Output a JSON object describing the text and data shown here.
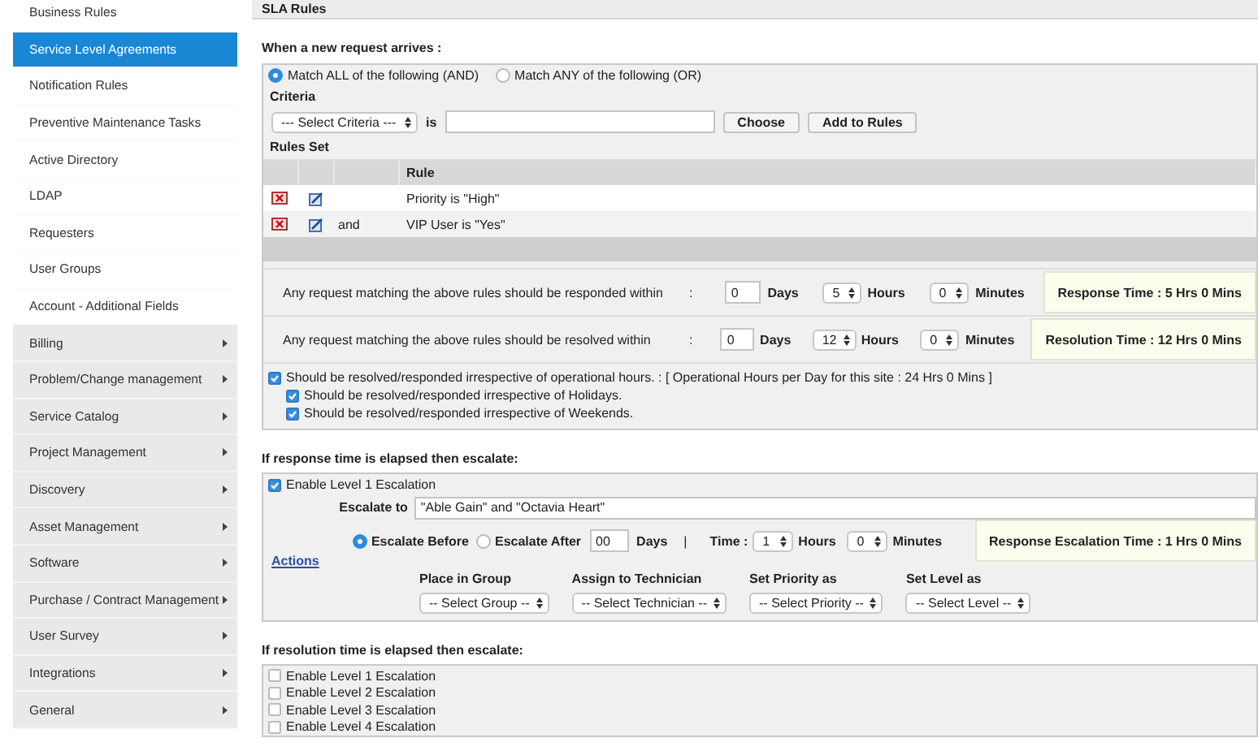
{
  "sidebar": {
    "items": [
      {
        "label": "Business Rules",
        "selected": false,
        "has_submenu": false
      },
      {
        "label": "Service Level Agreements",
        "selected": true,
        "has_submenu": false
      },
      {
        "label": "Notification Rules",
        "selected": false,
        "has_submenu": false
      },
      {
        "label": "Preventive Maintenance Tasks",
        "selected": false,
        "has_submenu": false
      },
      {
        "label": "Active Directory",
        "selected": false,
        "has_submenu": false
      },
      {
        "label": "LDAP",
        "selected": false,
        "has_submenu": false
      },
      {
        "label": "Requesters",
        "selected": false,
        "has_submenu": false
      },
      {
        "label": "User Groups",
        "selected": false,
        "has_submenu": false
      },
      {
        "label": "Account - Additional Fields",
        "selected": false,
        "has_submenu": false
      },
      {
        "label": "Billing",
        "selected": false,
        "has_submenu": true
      },
      {
        "label": "Problem/Change management",
        "selected": false,
        "has_submenu": true
      },
      {
        "label": "Service Catalog",
        "selected": false,
        "has_submenu": true
      },
      {
        "label": "Project Management",
        "selected": false,
        "has_submenu": true
      },
      {
        "label": "Discovery",
        "selected": false,
        "has_submenu": true
      },
      {
        "label": "Asset Management",
        "selected": false,
        "has_submenu": true
      },
      {
        "label": "Software",
        "selected": false,
        "has_submenu": true
      },
      {
        "label": "Purchase / Contract Management",
        "selected": false,
        "has_submenu": true
      },
      {
        "label": "User Survey",
        "selected": false,
        "has_submenu": true
      },
      {
        "label": "Integrations",
        "selected": false,
        "has_submenu": true
      },
      {
        "label": "General",
        "selected": false,
        "has_submenu": true
      }
    ]
  },
  "panel": {
    "title": "SLA Rules"
  },
  "new_request": {
    "heading": "When a new request arrives :",
    "match_options": [
      {
        "label": "Match ALL of the following (AND)",
        "selected": true
      },
      {
        "label": "Match ANY of the following (OR)",
        "selected": false
      }
    ],
    "criteria_label": "Criteria",
    "criteria_select": "--- Select Criteria ---",
    "is_label": "is",
    "choose_button": "Choose",
    "add_button": "Add to Rules",
    "rules_set_label": "Rules Set",
    "rules_table": {
      "columns": [
        "Rule"
      ],
      "rows": [
        {
          "connector": "",
          "rule": "Priority is \"High\""
        },
        {
          "connector": "and",
          "rule": "VIP User is \"Yes\""
        }
      ]
    },
    "times": [
      {
        "label": "Any request matching the above rules should be responded within",
        "separator": ":",
        "days": "0",
        "days_label": "Days",
        "hours": "5",
        "hours_label": "Hours",
        "minutes": "0",
        "minutes_label": "Minutes",
        "summary": "Response Time : 5 Hrs 0 Mins"
      },
      {
        "label": "Any request matching the above rules should be resolved within",
        "separator": ":",
        "days": "0",
        "days_label": "Days",
        "hours": "12",
        "hours_label": "Hours",
        "minutes": "0",
        "minutes_label": "Minutes",
        "summary": "Resolution Time : 12 Hrs 0 Mins"
      }
    ],
    "options": [
      {
        "label": "Should be resolved/responded irrespective of operational hours. : [ Operational Hours per Day for this site :  24 Hrs 0 Mins ]",
        "checked": true,
        "children": [
          {
            "label": "Should be resolved/responded irrespective of Holidays.",
            "checked": true
          },
          {
            "label": "Should be resolved/responded irrespective of Weekends.",
            "checked": true
          }
        ]
      }
    ]
  },
  "response_escalation": {
    "heading": "If response time is elapsed then escalate:",
    "level": {
      "label": "Enable Level 1 Escalation",
      "checked": true,
      "escalate_to_label": "Escalate to",
      "escalate_to": "\"Able Gain\" and \"Octavia Heart\"",
      "timing": [
        {
          "label": "Escalate Before",
          "selected": true
        },
        {
          "label": "Escalate After",
          "selected": false
        }
      ],
      "days": "00",
      "days_label": "Days",
      "divider": "|",
      "time_label": "Time :",
      "hours": "1",
      "hours_label": "Hours",
      "minutes": "0",
      "minutes_label": "Minutes",
      "summary": "Response Escalation Time : 1 Hrs 0 Mins",
      "actions_link": "Actions",
      "actions": [
        {
          "label": "Place in Group",
          "select": "-- Select Group --"
        },
        {
          "label": "Assign to Technician",
          "select": "-- Select Technician --"
        },
        {
          "label": "Set Priority as",
          "select": "-- Select Priority --"
        },
        {
          "label": "Set Level as",
          "select": "-- Select Level --"
        }
      ]
    }
  },
  "resolution_escalation": {
    "heading": "If resolution time is elapsed then escalate:",
    "levels": [
      {
        "label": "Enable Level 1 Escalation",
        "checked": false
      },
      {
        "label": "Enable Level 2 Escalation",
        "checked": false
      },
      {
        "label": "Enable Level 3 Escalation",
        "checked": false
      },
      {
        "label": "Enable Level 4 Escalation",
        "checked": false
      }
    ]
  }
}
